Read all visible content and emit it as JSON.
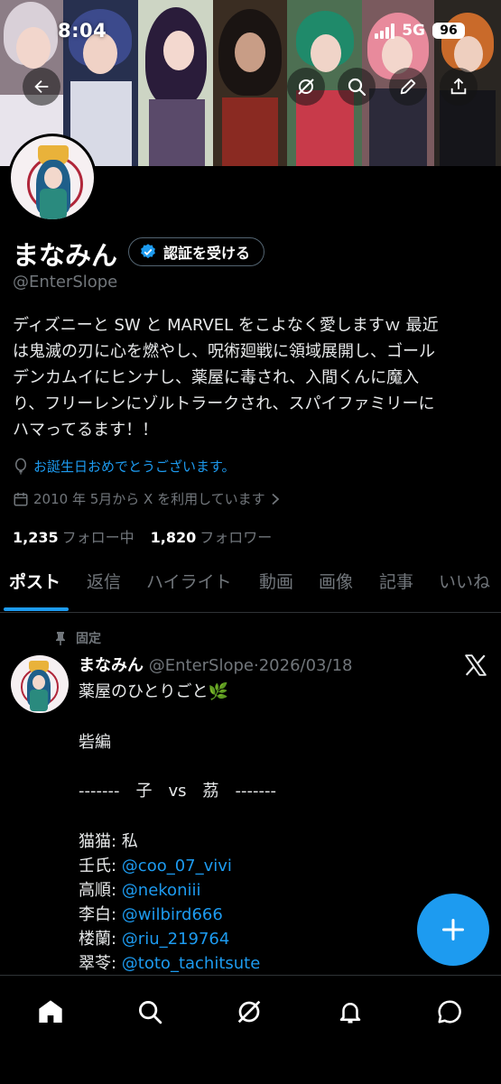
{
  "status_bar": {
    "time": "8:04",
    "network": "5G",
    "battery": "96"
  },
  "profile": {
    "display_name": "まなみん",
    "verify_label": "認証を受ける",
    "handle": "@EnterSlope",
    "bio_lines": [
      "ディズニーと SW と MARVEL をこよなく愛しますｗ 最近",
      "は鬼滅の刃に心を燃やし、呪術廻戦に領域展開し、ゴール",
      "デンカムイにヒンナし、薬屋に毒され、入間くんに魔入",
      "り、フリーレンにゾルトラークされ、スパイファミリーに",
      "ハマってるます！！"
    ],
    "birthday_text": "お誕生日おめでとうございます。",
    "joined_text": "2010 年 5月から X を利用しています",
    "following_count": "1,235",
    "following_label": "フォロー中",
    "followers_count": "1,820",
    "followers_label": "フォロワー"
  },
  "tabs": [
    {
      "label": "ポスト",
      "active": true
    },
    {
      "label": "返信"
    },
    {
      "label": "ハイライト"
    },
    {
      "label": "動画"
    },
    {
      "label": "画像"
    },
    {
      "label": "記事"
    },
    {
      "label": "いいね"
    }
  ],
  "pinned_tweet": {
    "pinned_label": "固定",
    "author_name": "まなみん",
    "author_handle": "@EnterSlope",
    "separator": "·",
    "date": "2026/03/18",
    "text_lines": [
      "薬屋のひとりごと🌿",
      "",
      "砦編",
      "",
      "-------　子　vs　茘　-------",
      ""
    ],
    "cast": [
      {
        "role": "猫猫: ",
        "text": "私",
        "is_mention": false
      },
      {
        "role": "壬氏: ",
        "text": "@coo_07_vivi",
        "is_mention": true
      },
      {
        "role": "高順: ",
        "text": "@nekoniii",
        "is_mention": true
      },
      {
        "role": "李白: ",
        "text": "@wilbird666",
        "is_mention": true
      },
      {
        "role": "楼蘭: ",
        "text": "@riu_219764",
        "is_mention": true
      },
      {
        "role": "翠苓: ",
        "text": "@toto_tachitsute",
        "is_mention": true
      }
    ]
  },
  "icons": {
    "back": "back-arrow-icon",
    "grok": "grok-icon",
    "search": "search-icon",
    "edit": "pencil-icon",
    "share": "share-icon",
    "verified": "verified-badge-icon",
    "balloon": "balloon-icon",
    "calendar": "calendar-icon",
    "chevron": "chevron-right-icon",
    "pin": "pin-icon",
    "x_logo": "x-logo-icon",
    "fab": "plus-icon",
    "nav": [
      "home-icon",
      "search-icon",
      "grok-icon",
      "bell-icon",
      "messages-icon"
    ]
  },
  "colors": {
    "accent": "#1d9bf0",
    "background": "#000000",
    "secondary_text": "#71767b",
    "primary_text": "#e7e9ea"
  }
}
